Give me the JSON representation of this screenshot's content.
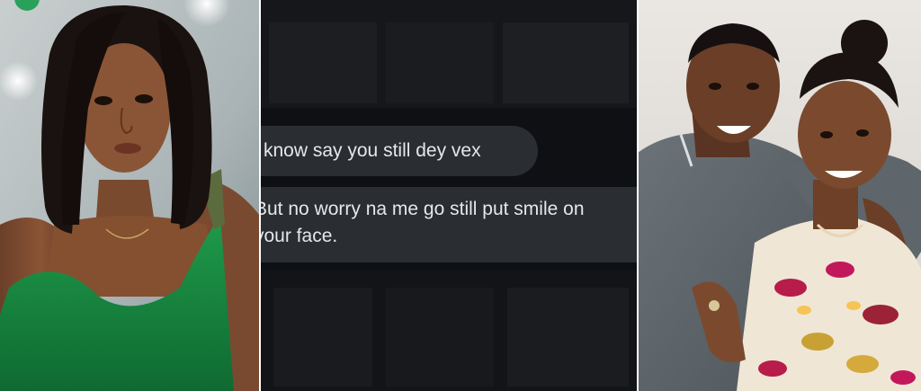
{
  "collage": {
    "left_photo": {
      "subject": "woman-green-top-photo"
    },
    "chat": {
      "message_1": "know say you still dey vex",
      "message_2_line_1": "But no worry na me go still put smile on",
      "message_2_line_2": "your face."
    },
    "right_photo": {
      "subject": "man-and-older-woman-photo"
    }
  }
}
